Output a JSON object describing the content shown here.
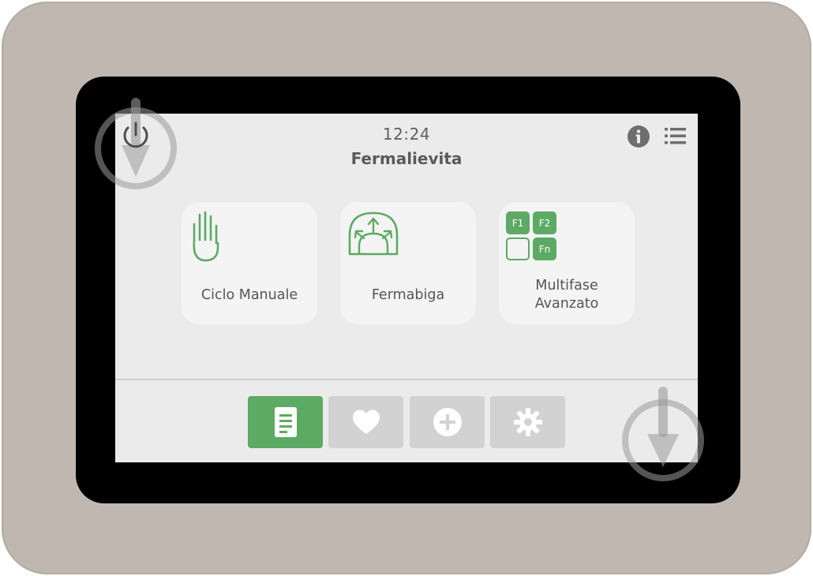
{
  "status": {
    "time": "12:24"
  },
  "header": {
    "title": "Fermalievita"
  },
  "icons": {
    "power": "power-icon",
    "info": "info-icon",
    "menu": "list-menu-icon",
    "scroll_down": "scroll-down-arrow-icon"
  },
  "tiles": [
    {
      "label": "Ciclo Manuale",
      "icon": "hand-icon"
    },
    {
      "label": "Fermabiga",
      "icon": "fermabiga-dome-icon"
    },
    {
      "label_line1": "Multifase",
      "label_line2": "Avanzato",
      "icon": "multiphase-grid-icon",
      "phase_labels": [
        "F1",
        "F2",
        "Fn"
      ]
    }
  ],
  "navbar": [
    {
      "icon": "document-icon",
      "active": true
    },
    {
      "icon": "heart-icon",
      "active": false
    },
    {
      "icon": "plus-circle-icon",
      "active": false
    },
    {
      "icon": "gear-icon",
      "active": false
    }
  ],
  "colors": {
    "accent": "#5daa64",
    "device_frame": "#c0b8b0",
    "screen_bg": "#ebebeb",
    "tile_bg": "#f4f4f4",
    "nav_inactive": "#d2d2d2"
  }
}
